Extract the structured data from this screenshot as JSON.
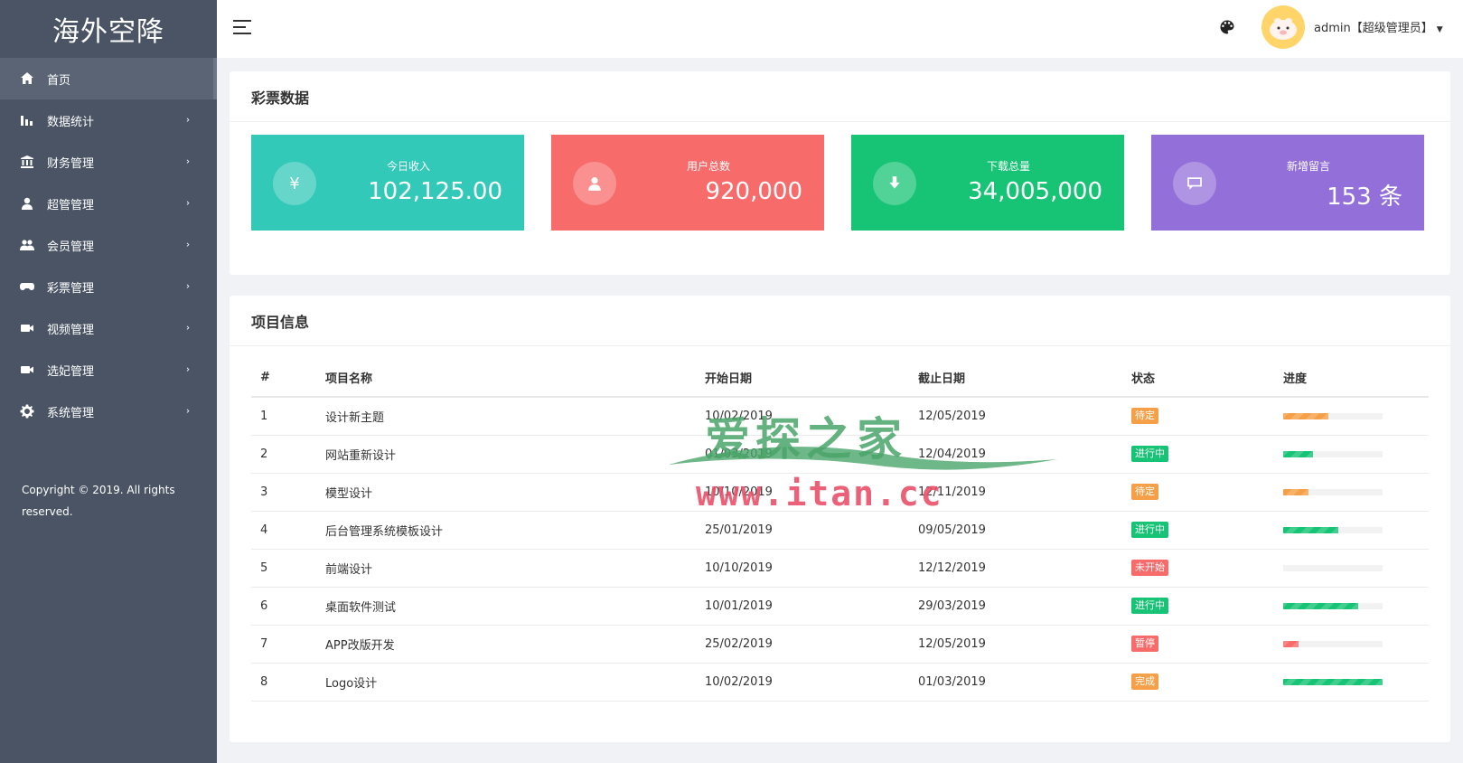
{
  "brand": "海外空降",
  "sidebar": {
    "items": [
      {
        "label": "首页",
        "icon": "home-icon",
        "has_arrow": false,
        "active": true
      },
      {
        "label": "数据统计",
        "icon": "bar-chart-icon",
        "has_arrow": true,
        "active": false
      },
      {
        "label": "财务管理",
        "icon": "bank-icon",
        "has_arrow": true,
        "active": false
      },
      {
        "label": "超管管理",
        "icon": "user-icon",
        "has_arrow": true,
        "active": false
      },
      {
        "label": "会员管理",
        "icon": "users-icon",
        "has_arrow": true,
        "active": false
      },
      {
        "label": "彩票管理",
        "icon": "gamepad-icon",
        "has_arrow": true,
        "active": false
      },
      {
        "label": "视频管理",
        "icon": "video-icon",
        "has_arrow": true,
        "active": false
      },
      {
        "label": "选妃管理",
        "icon": "video-icon",
        "has_arrow": true,
        "active": false
      },
      {
        "label": "系统管理",
        "icon": "gear-icon",
        "has_arrow": true,
        "active": false
      }
    ],
    "arrow": "›",
    "copyright": "Copyright © 2019. All rights reserved."
  },
  "topbar": {
    "user": "admin【超级管理员】"
  },
  "lottery_card": {
    "title": "彩票数据",
    "stats": [
      {
        "label": "今日收入",
        "value": "102,125.00",
        "icon": "yen-icon",
        "glyph": "¥",
        "color": "#33c9b9"
      },
      {
        "label": "用户总数",
        "value": "920,000",
        "icon": "user-icon",
        "glyph": "",
        "color": "#f86b6b"
      },
      {
        "label": "下载总量",
        "value": "34,005,000",
        "icon": "download-icon",
        "glyph": "",
        "color": "#17c375"
      },
      {
        "label": "新增留言",
        "value": "153 条",
        "icon": "comment-icon",
        "glyph": "",
        "color": "#9370d9"
      }
    ]
  },
  "project_card": {
    "title": "项目信息",
    "columns": [
      "#",
      "项目名称",
      "开始日期",
      "截止日期",
      "状态",
      "进度"
    ],
    "rows": [
      {
        "id": "1",
        "name": "设计新主题",
        "start": "10/02/2019",
        "end": "12/05/2019",
        "status": "待定",
        "status_color": "#f5a048",
        "progress": 0.45,
        "progress_color": "#f5a048"
      },
      {
        "id": "2",
        "name": "网站重新设计",
        "start": "01/03/2019",
        "end": "12/04/2019",
        "status": "进行中",
        "status_color": "#17c375",
        "progress": 0.3,
        "progress_color": "#17c375"
      },
      {
        "id": "3",
        "name": "模型设计",
        "start": "10/10/2019",
        "end": "12/11/2019",
        "status": "待定",
        "status_color": "#f5a048",
        "progress": 0.25,
        "progress_color": "#f5a048"
      },
      {
        "id": "4",
        "name": "后台管理系统模板设计",
        "start": "25/01/2019",
        "end": "09/05/2019",
        "status": "进行中",
        "status_color": "#17c375",
        "progress": 0.55,
        "progress_color": "#17c375"
      },
      {
        "id": "5",
        "name": "前端设计",
        "start": "10/10/2019",
        "end": "12/12/2019",
        "status": "未开始",
        "status_color": "#f86b6b",
        "progress": 0,
        "progress_color": "#f86b6b"
      },
      {
        "id": "6",
        "name": "桌面软件测试",
        "start": "10/01/2019",
        "end": "29/03/2019",
        "status": "进行中",
        "status_color": "#17c375",
        "progress": 0.75,
        "progress_color": "#17c375"
      },
      {
        "id": "7",
        "name": "APP改版开发",
        "start": "25/02/2019",
        "end": "12/05/2019",
        "status": "暂停",
        "status_color": "#f86b6b",
        "progress": 0.15,
        "progress_color": "#f86b6b"
      },
      {
        "id": "8",
        "name": "Logo设计",
        "start": "10/02/2019",
        "end": "01/03/2019",
        "status": "完成",
        "status_color": "#f5a048",
        "progress": 1.0,
        "progress_color": "#17c375"
      }
    ]
  },
  "watermark": {
    "cn": "爱探之家",
    "en": "www.itan.cc"
  }
}
